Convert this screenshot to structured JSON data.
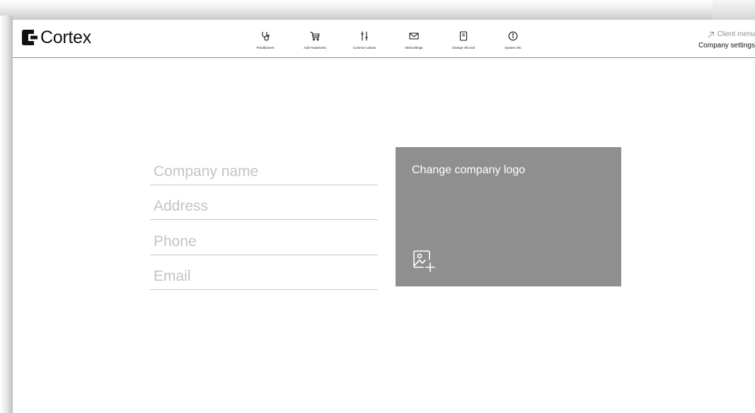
{
  "brand": {
    "name": "Cortex"
  },
  "nav": {
    "items": [
      {
        "label": "Practitioners",
        "icon": "stethoscope-icon"
      },
      {
        "label": "Add Treatments",
        "icon": "cart-icon"
      },
      {
        "label": "Common values",
        "icon": "sliders-icon"
      },
      {
        "label": "Mail settings",
        "icon": "mail-icon"
      },
      {
        "label": "Change info text",
        "icon": "document-icon"
      },
      {
        "label": "System info",
        "icon": "info-icon"
      }
    ]
  },
  "header_right": {
    "client_menu": "Client menu",
    "current_page": "Company settings"
  },
  "form": {
    "company_name_placeholder": "Company name",
    "address_placeholder": "Address",
    "phone_placeholder": "Phone",
    "email_placeholder": "Email"
  },
  "logo_panel": {
    "title": "Change company logo",
    "icon": "image-add-icon"
  },
  "colors": {
    "panel": "#8f8f8f",
    "divider": "#c7c7c7",
    "muted_text": "#8e8e8e",
    "placeholder": "#c4c4c4"
  }
}
